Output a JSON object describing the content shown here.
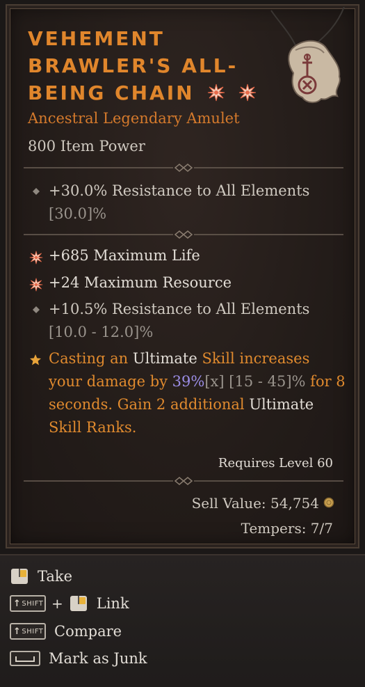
{
  "item": {
    "name": "Vehement Brawler's All-Being Chain",
    "rarity_type": "Ancestral Legendary Amulet",
    "item_power": "800 Item Power",
    "implicit": {
      "text": "+30.0% Resistance to All Elements",
      "range": "[30.0]%"
    },
    "affixes": [
      {
        "icon": "greater-affix-spark-icon",
        "text": "+685 Maximum Life"
      },
      {
        "icon": "greater-affix-spark-icon",
        "text": "+24 Maximum Resource"
      },
      {
        "icon": "diamond-bullet-icon",
        "text": "+10.5% Resistance to All Elements",
        "range": "[10.0 - 12.0]%"
      }
    ],
    "legendary_aspect": {
      "icon": "star-icon",
      "part1": "Casting an ",
      "part2": "Ultimate",
      "part3": " Skill increases your damage by ",
      "value": "39%",
      "value_mark": "[x]",
      "range": " [15 - 45]%",
      "part4": " for 8 seconds. Gain 2 additional ",
      "part5": "Ultimate",
      "part6": " Skill Ranks."
    },
    "requires_level": "Requires Level 60",
    "sell_value": "Sell Value: 54,754",
    "tempers": "Tempers: 7/7"
  },
  "actions": {
    "take": "Take",
    "link": "Link",
    "compare": "Compare",
    "junk": "Mark as Junk",
    "shift_key": "SHIFT",
    "plus": "+"
  },
  "colors": {
    "legendary_orange": "#e0862c",
    "text_white": "#e2ddd6",
    "roll_purple": "#9b8de6",
    "panel_bg": "#231c19"
  }
}
